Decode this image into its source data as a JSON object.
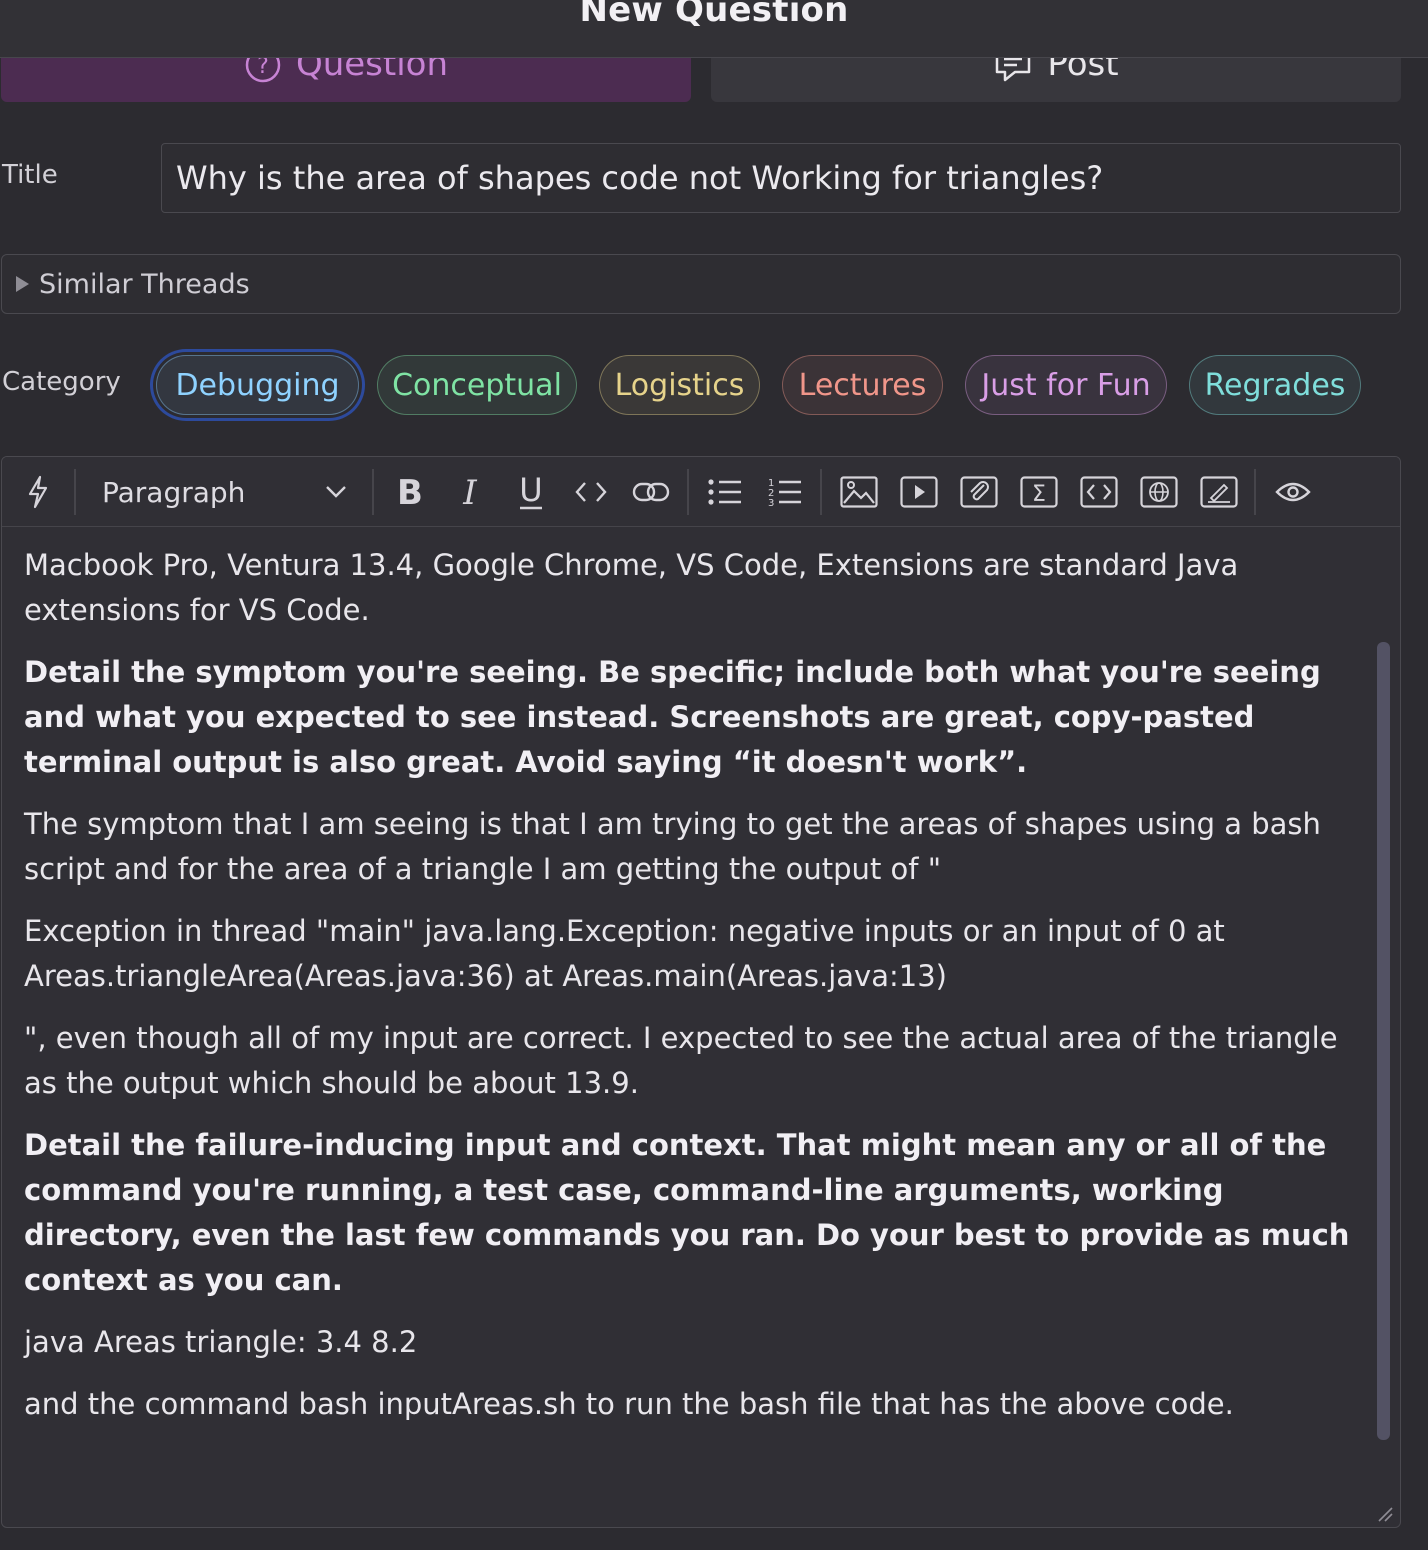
{
  "header": {
    "title": "New Question"
  },
  "post_type": {
    "question_label": "Question",
    "post_label": "Post"
  },
  "title_field": {
    "label": "Title",
    "value": "Why is the area of shapes code not Working for triangles?"
  },
  "similar_threads": {
    "label": "Similar Threads"
  },
  "category": {
    "label": "Category",
    "options": [
      {
        "label": "Debugging",
        "color": "#8fd2ff",
        "selected": true
      },
      {
        "label": "Conceptual",
        "color": "#7fe3a4"
      },
      {
        "label": "Logistics",
        "color": "#e6d38b"
      },
      {
        "label": "Lectures",
        "color": "#f0968a"
      },
      {
        "label": "Just for Fun",
        "color": "#d99ee6"
      },
      {
        "label": "Regrades",
        "color": "#7fdedb"
      }
    ]
  },
  "editor": {
    "toolbar": {
      "paragraph_style": "Paragraph",
      "icons": [
        "ai-assist-icon",
        "bold-icon",
        "italic-icon",
        "underline-icon",
        "code-icon",
        "link-icon",
        "bullet-list-icon",
        "numbered-list-icon",
        "image-icon",
        "video-icon",
        "attachment-icon",
        "math-icon",
        "code-block-icon",
        "web-embed-icon",
        "draw-icon",
        "preview-icon"
      ]
    },
    "paragraphs": [
      {
        "text": "Macbook Pro, Ventura 13.4, Google Chrome, VS Code, Extensions are standard Java extensions for VS Code.",
        "bold": false
      },
      {
        "text": "Detail the symptom you're seeing. Be specific; include both what you're seeing and what you expected to see instead. Screenshots are great, copy-pasted terminal output is also great. Avoid saying “it doesn't work”.",
        "bold": true
      },
      {
        "text": "The symptom that I am seeing is that I am trying to get the areas of shapes using a bash script and for the area of a triangle I am getting the output of \"",
        "bold": false
      },
      {
        "text": "Exception in thread \"main\" java.lang.Exception: negative inputs or an input of 0 at Areas.triangleArea(Areas.java:36) at Areas.main(Areas.java:13)",
        "bold": false
      },
      {
        "text": "\", even though all of my input are correct. I expected to see the actual area of the triangle as the output which should be about 13.9.",
        "bold": false
      },
      {
        "text": "Detail the failure-inducing input and context. That might mean any or all of the command you're running, a test case, command-line arguments, working directory, even the last few commands you ran. Do your best to provide as much context as you can.",
        "bold": true
      },
      {
        "text": "java Areas triangle: 3.4 8.2",
        "bold": false
      },
      {
        "text": "and the command bash inputAreas.sh to run the bash file that has the above code.",
        "bold": false
      }
    ]
  }
}
